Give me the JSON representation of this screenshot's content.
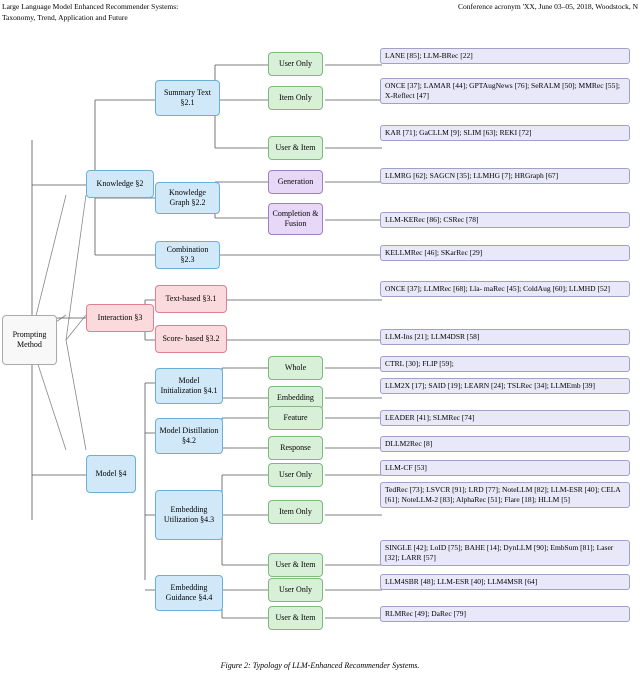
{
  "header": {
    "left_line1": "Large Language Model Enhanced Recommender Systems:",
    "left_line2": "Taxonomy, Trend, Application and Future",
    "right": "Conference acronym 'XX, June 03–05, 2018, Woodstock, N"
  },
  "caption": "Figure 2: Typology of LLM-Enhanced Recommender Systems.",
  "nodes": {
    "prompting_method": "Prompting\nMethod",
    "knowledge": "Knowledge §2",
    "interaction": "Interaction §3",
    "model": "Model\n§4",
    "summary_text": "Summary\nText §2.1",
    "knowledge_graph": "Knowledge\nGraph §2.2",
    "combination": "Combination\n§2.3",
    "text_based": "Text-based §3.1",
    "score_based": "Score-\nbased §3.2",
    "model_init": "Model\nInitialization\n§4.1",
    "model_distil": "Model\nDistillation\n§4.2",
    "embedding_util": "Embedding\nUtilization §4.3",
    "embedding_guide": "Embedding\nGuidance §4.4",
    "user_only_1": "User Only",
    "item_only_1": "Item Only",
    "user_item_1": "User & Item",
    "generation": "Generation",
    "completion_fusion": "Completion\n& Fusion",
    "whole": "Whole",
    "embedding_m": "Embedding",
    "feature": "Feature",
    "response": "Response",
    "user_only_2": "User Only",
    "item_only_2": "Item Only",
    "user_item_2": "User & Item",
    "user_only_3": "User Only",
    "user_item_3": "User & Item"
  },
  "results": {
    "r1": "LANE [85]; LLM-BRec [22]",
    "r2": "ONCE [37]; LAMAR [44]; GPTAugNews [76];\nSeRALM [50]; MMRec [55]; X-Reflect [47]",
    "r3": "KAR [71]; GaCLLM [9];\nSLIM [63]; REKI [72]",
    "r4": "LLMRG [62]; SAGCN [35];\nLLMHG [7]; HRGraph [67]",
    "r5": "LLM-KERec [86]; CSRec [78]",
    "r6": "KELLMRec [46]; SKarRec [29]",
    "r7": "ONCE [37]; LLMRec [68]; Lla-\nmaRec [45]; ColdAug [60]; LLMHD [52]",
    "r8": "LLM-Ins [21]; LLM4DSR [58]",
    "r9": "CTRL [30]; FLIP [59];",
    "r10": "LLM2X [17]; SAID [19]; LEARN [24];\nTSLRec [34]; LLMEmb [39]",
    "r11": "LEADER [41]; SLMRec [74]",
    "r12": "DLLM2Rec [8]",
    "r13": "LLM-CF [53]",
    "r14": "TedRec [73]; LSVCR [91]; LRD [77];\nNoteLLM [82]; LLM-ESR [40];\nCELA [61]; NoteLLM-2 [83];\nAlphaRec [51]; Flare [18]; HLLM [5]",
    "r15": "SINGLE [42]; LoID [75];\nBAHE [14]; DynLLM [90];\nEmbSum [81]; Laser [32]; LARR [57]",
    "r16": "LLM4SBR [48]; LLM-ESR [40];\nLLM4MSR [64]",
    "r17": "RLMRec [49]; DaRec [79]"
  }
}
